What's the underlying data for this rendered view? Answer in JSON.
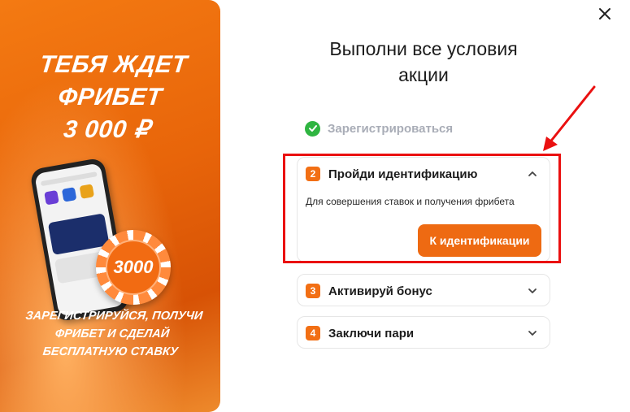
{
  "banner": {
    "title_lines": [
      "ТЕБЯ ЖДЕТ",
      "ФРИБЕТ",
      "3 000 ₽"
    ],
    "chip_value": "3000",
    "subtitle_lines": [
      "ЗАРЕГИСТРИРУЙСЯ, ПОЛУЧИ",
      "ФРИБЕТ И СДЕЛАЙ",
      "БЕСПЛАТНУЮ СТАВКУ"
    ]
  },
  "close_icon": "close-icon",
  "heading_lines": [
    "Выполни все условия",
    "акции"
  ],
  "steps": {
    "done": {
      "label": "Зарегистрироваться",
      "icon": "check-circle-icon"
    },
    "step2": {
      "number": "2",
      "title": "Пройди идентификацию",
      "description": "Для совершения ставок и получения фрибета",
      "button": "К идентификации",
      "expanded": true
    },
    "step3": {
      "number": "3",
      "title": "Активируй бонус",
      "expanded": false
    },
    "step4": {
      "number": "4",
      "title": "Заключи пари",
      "expanded": false
    }
  },
  "colors": {
    "accent": "#ee6a12",
    "success": "#2fb541",
    "highlight": "#ea1010"
  }
}
